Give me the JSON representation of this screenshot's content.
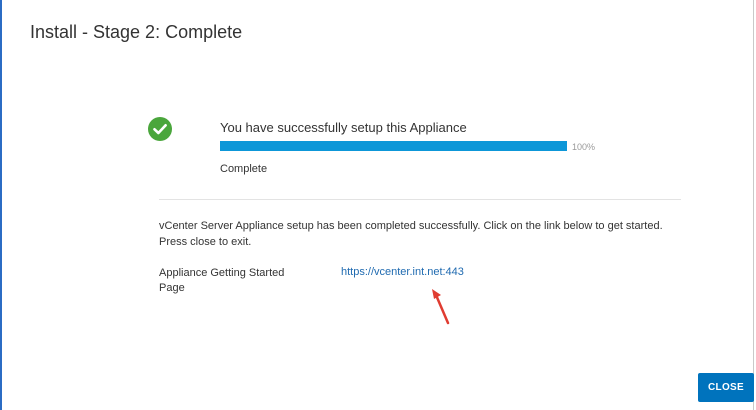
{
  "dialog": {
    "title": "Install - Stage 2: Complete"
  },
  "status_block": {
    "icon": "check-circle-icon",
    "icon_color": "#4aa63c",
    "message": "You have successfully setup this Appliance",
    "progress": 100,
    "progress_label": "100%",
    "progress_color": "#0d97d8",
    "status_text": "Complete"
  },
  "description": "vCenter Server Appliance setup has been completed successfully. Click on the link below to get started. Press close to exit.",
  "getting_started": {
    "label": "Appliance Getting Started Page",
    "link_text": "https://vcenter.int.net:443"
  },
  "annotation": {
    "icon": "red-arrow-icon",
    "color": "#e03c31"
  },
  "footer": {
    "close_label": "CLOSE",
    "close_color": "#0073bd"
  }
}
